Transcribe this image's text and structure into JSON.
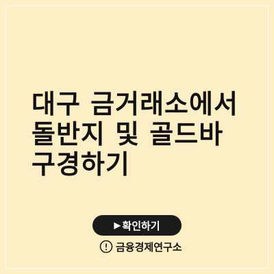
{
  "colors": {
    "background": "#fdefc5",
    "border": "#ffffff",
    "title": "#111111",
    "button_background": "#1b1b1b",
    "button_text": "#ffffff",
    "source_text": "#151515"
  },
  "title": {
    "lines": [
      "대구 금거래소에서",
      "돌반지 및 골드바",
      "구경하기"
    ]
  },
  "button": {
    "icon": "play-icon",
    "label": "확인하기"
  },
  "source": {
    "icon": "info-circle-icon",
    "label": "금융경제연구소"
  }
}
